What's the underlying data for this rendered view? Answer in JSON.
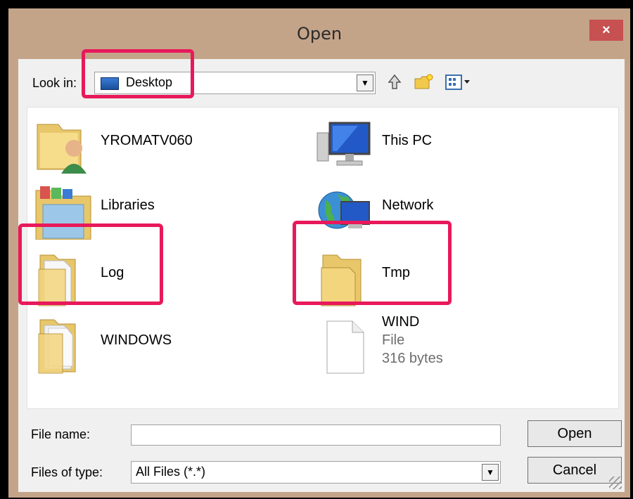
{
  "window": {
    "title": "Open",
    "close_label": "×"
  },
  "lookin": {
    "label": "Look in:",
    "value": "Desktop"
  },
  "items": [
    {
      "name": "YROMATV060",
      "icon": "user-folder-icon"
    },
    {
      "name": "This PC",
      "icon": "computer-icon"
    },
    {
      "name": "Libraries",
      "icon": "libraries-icon"
    },
    {
      "name": "Network",
      "icon": "network-icon"
    },
    {
      "name": "Log",
      "icon": "folder-icon"
    },
    {
      "name": "Tmp",
      "icon": "folder-icon"
    },
    {
      "name": "WINDOWS",
      "icon": "folder-icon"
    },
    {
      "name": "WIND",
      "icon": "file-icon",
      "type": "File",
      "size": "316 bytes"
    }
  ],
  "filename": {
    "label": "File name:",
    "value": ""
  },
  "filetype": {
    "label": "Files of type:",
    "value": "All Files (*.*)"
  },
  "buttons": {
    "open": "Open",
    "cancel": "Cancel"
  },
  "colors": {
    "highlight": "#e8195b",
    "close": "#c75050",
    "frame": "#c4a489"
  }
}
